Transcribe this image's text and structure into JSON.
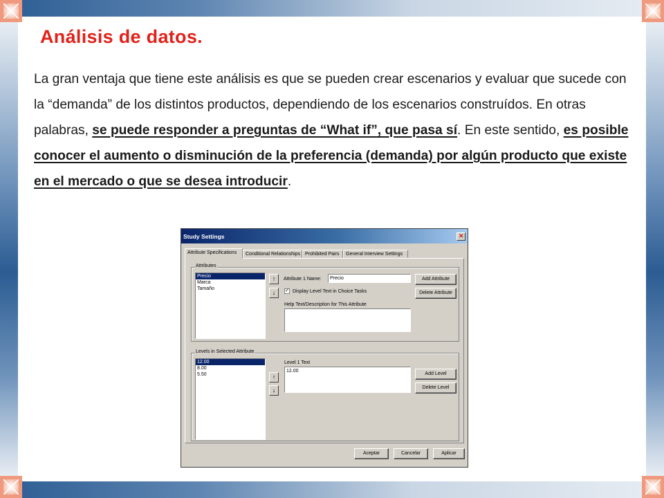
{
  "slide": {
    "title": "Análisis de datos.",
    "paragraph": {
      "text1": "La gran ventaja que tiene este análisis es que se pueden crear escenarios y evaluar que sucede con la “demanda” de los distintos productos, dependiendo de los escenarios construídos. En otras palabras, ",
      "link1": "se puede responder a preguntas de “What if”, que pasa sí",
      "text2": ". En este sentido, ",
      "link2": "es posible conocer el aumento o disminución de la preferencia (demanda) por algún producto que existe en el mercado o que se desea introducir",
      "text3": "."
    }
  },
  "dialog": {
    "title": "Study Settings",
    "tabs": [
      "Attribute Specifications",
      "Conditional Relationships",
      "Prohibited Pairs",
      "General Interview Settings"
    ],
    "attributes_group": {
      "label": "Attributes",
      "items": [
        "Precio",
        "Marca",
        "Tamaño"
      ],
      "selected_index": 0,
      "name_label": "Attribute 1 Name:",
      "name_value": "Precio",
      "checkbox_label": "Display Level Text in Choice Tasks",
      "checkbox_checked": true,
      "checkbox_mark": "✓",
      "help_label": "Help Text/Description for This Attribute",
      "add_button": "Add Attribute",
      "delete_button": "Delete Attribute"
    },
    "levels_group": {
      "label": "Levels in Selected Attribute",
      "items": [
        "12.00",
        "8.00",
        "5.50"
      ],
      "selected_index": 0,
      "text_label": "Level 1 Text",
      "text_value": "12.00",
      "add_button": "Add Level",
      "delete_button": "Delete Level"
    },
    "arrow_up": "↑",
    "arrow_down": "↓",
    "footer": {
      "ok": "Aceptar",
      "cancel": "Cancelar",
      "apply": "Aplicar"
    }
  }
}
